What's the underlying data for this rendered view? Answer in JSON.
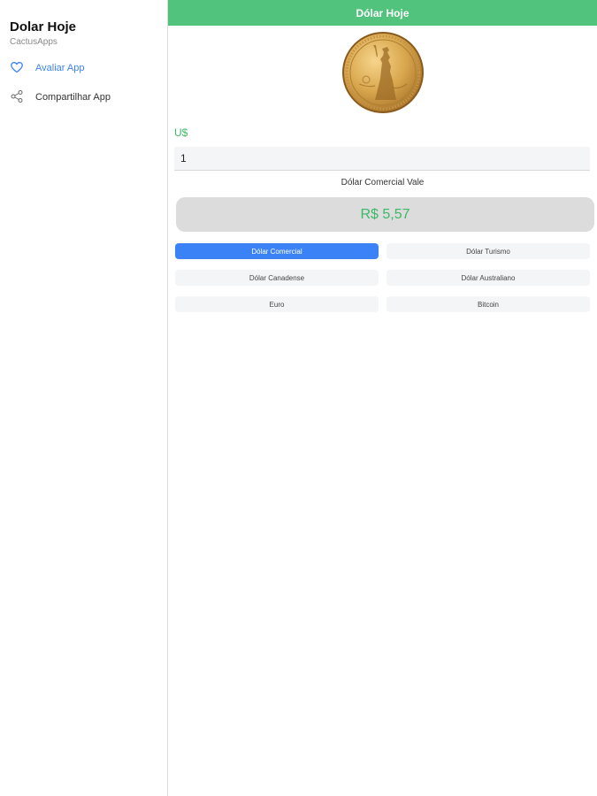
{
  "sidebar": {
    "title": "Dolar Hoje",
    "subtitle": "CactusApps",
    "items": [
      {
        "label": "Avaliar App",
        "icon": "heart-icon",
        "color": "#3b82f6"
      },
      {
        "label": "Compartilhar App",
        "icon": "share-icon",
        "color": "#333333"
      }
    ]
  },
  "header": {
    "title": "Dólar Hoje",
    "color": "#52c37d"
  },
  "converter": {
    "currency_symbol": "U$",
    "amount": "1",
    "caption": "Dólar Comercial Vale",
    "result": "R$ 5,57",
    "accent": "#3cb964"
  },
  "currencies": {
    "selected": "Dólar Comercial",
    "options": [
      "Dólar Comercial",
      "Dólar Turismo",
      "Dólar Canadense",
      "Dólar Australiano",
      "Euro",
      "Bitcoin"
    ],
    "active_color": "#3b82f6"
  }
}
